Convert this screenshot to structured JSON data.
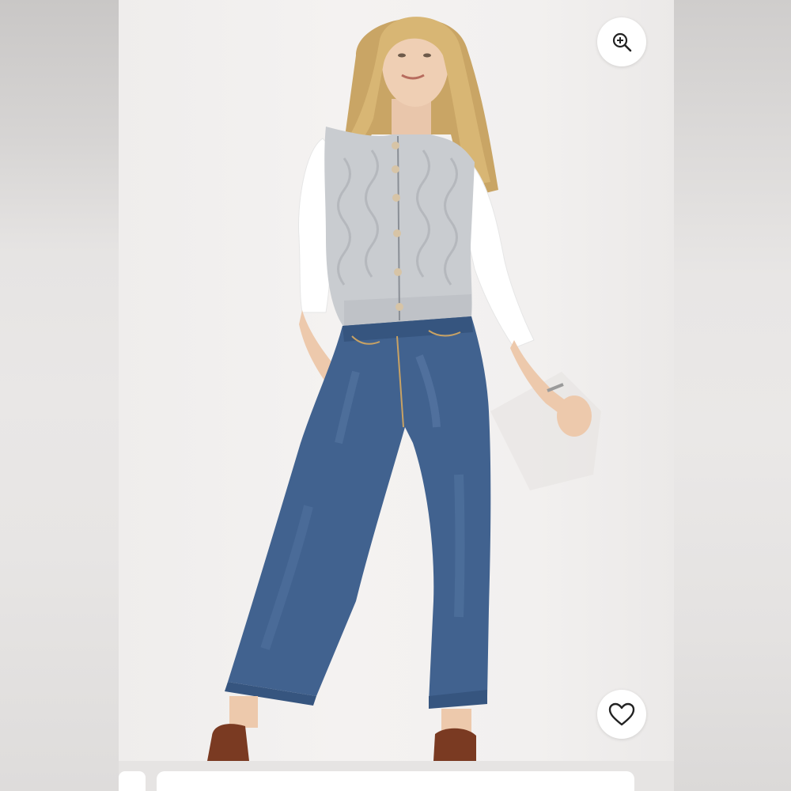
{
  "viewer": {
    "zoom_button": {
      "icon": "zoom-in-icon",
      "label": ""
    },
    "favorite_button": {
      "icon": "heart-icon",
      "label": ""
    }
  },
  "product_image": {
    "subject": "",
    "colors": {
      "vest": "#c9ccd0",
      "shirt": "#ffffff",
      "jeans": "#3f5f8c",
      "shoes": "#7a3a22",
      "hair": "#d9b878",
      "background": "#f2f0ef"
    }
  }
}
